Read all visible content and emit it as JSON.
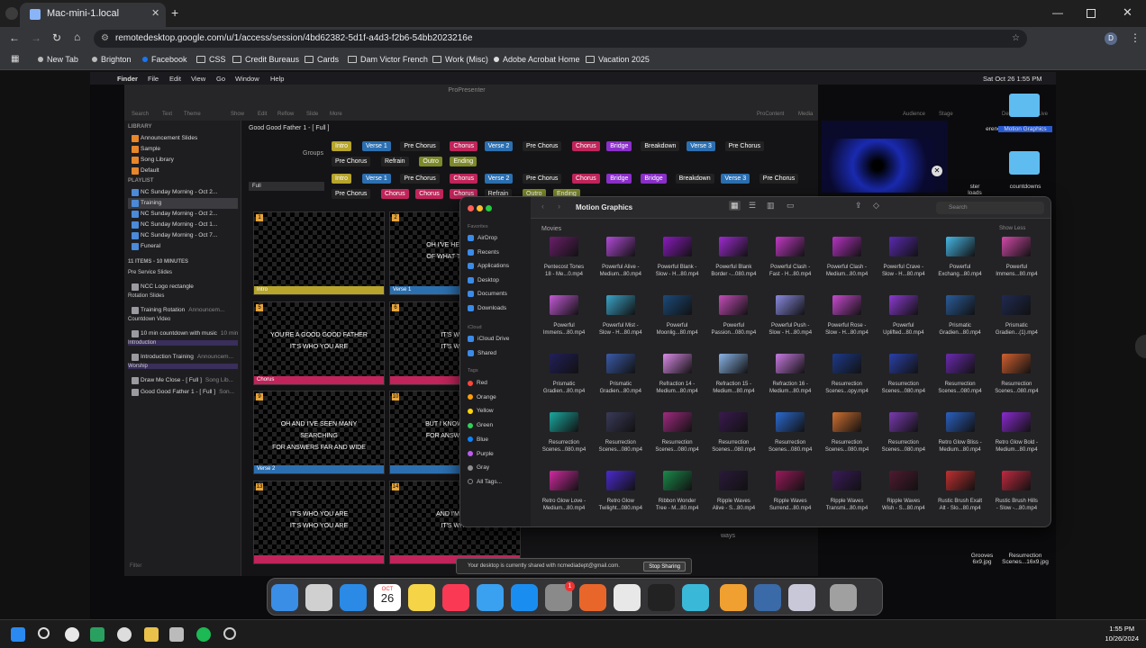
{
  "browser": {
    "tab_title": "Mac-mini-1.local",
    "url": "remotedesktop.google.com/u/1/access/session/4bd62382-5d1f-a4d3-f2b6-54bb2023216e",
    "bookmarks": [
      "New Tab",
      "Brighton",
      "Facebook",
      "CSS",
      "Credit Bureaus",
      "Cards",
      "Dam Victor French",
      "Work (Misc)",
      "Adobe Acrobat Home",
      "Vacation 2025"
    ],
    "profile_initial": "D"
  },
  "mac_menu": {
    "app": "Finder",
    "items": [
      "File",
      "Edit",
      "View",
      "Go",
      "Window",
      "Help"
    ],
    "clock": "Sat Oct 26  1:55 PM"
  },
  "pp": {
    "title": "ProPresenter",
    "toolbar": [
      "Search",
      "Text",
      "Theme",
      "Show",
      "Edit",
      "Reflow",
      "Slide",
      "More",
      "ProContent",
      "Media",
      "Audience",
      "Stage",
      "Default",
      "Live"
    ],
    "doc_title": "Good Good Father 1 - [ Full ]",
    "groups_label": "Groups",
    "arrangement": "Full",
    "library_header": "LIBRARY",
    "library": [
      "Announcement Slides",
      "Sample",
      "Song Library",
      "Default"
    ],
    "playlist_header": "PLAYLIST",
    "playlists": [
      "NC Sunday Morning - Oct 2...",
      "Training",
      "NC Sunday Morning - Oct 2...",
      "NC Sunday Morning - Oct 1...",
      "NC Sunday Morning - Oct 7...",
      "Funeral"
    ],
    "items_count": "11 ITEMS - 10 MINUTES",
    "items": [
      {
        "hdr": "Pre Service Slides"
      },
      {
        "row": "NCC Logo rectangle"
      },
      {
        "hdr": "Rotation Slides"
      },
      {
        "row": "Training Rotation",
        "meta": "Announcem..."
      },
      {
        "hdr": "Countdown Video"
      },
      {
        "row": "10 min countdown with music",
        "meta": "10 min..."
      },
      {
        "hdr": "Introduction"
      },
      {
        "row": "Introduction Training",
        "meta": "Announcem..."
      },
      {
        "hdr": "Worship"
      },
      {
        "row": "Draw Me Close - [ Full ]",
        "meta": "Song Lib..."
      },
      {
        "row": "Good Good Father 1 - [ Full ]",
        "meta": "Son..."
      }
    ],
    "filter": "Filter",
    "group_row1": [
      {
        "t": "Intro",
        "c": "#b7a52c"
      },
      {
        "t": "Verse 1",
        "c": "#2c6fb0"
      },
      {
        "t": "Pre Chorus",
        "c": "#222"
      },
      {
        "t": "Chorus",
        "c": "#c0245a"
      },
      {
        "t": "Verse 2",
        "c": "#2c6fb0"
      },
      {
        "t": "Pre Chorus",
        "c": "#222"
      },
      {
        "t": "Chorus",
        "c": "#c0245a"
      },
      {
        "t": "Bridge",
        "c": "#8b2fc9"
      },
      {
        "t": "Breakdown",
        "c": "#222"
      },
      {
        "t": "Verse 3",
        "c": "#2c6fb0"
      },
      {
        "t": "Pre Chorus",
        "c": "#222"
      }
    ],
    "group_row2": [
      {
        "t": "Pre Chorus",
        "c": "#222"
      },
      {
        "t": "Refrain",
        "c": "#222"
      },
      {
        "t": "Outro",
        "c": "#7d8a2a"
      },
      {
        "t": "Ending",
        "c": "#7d8a2a"
      }
    ],
    "arr_row1": [
      {
        "t": "Intro",
        "c": "#b7a52c"
      },
      {
        "t": "Verse 1",
        "c": "#2c6fb0"
      },
      {
        "t": "Pre Chorus",
        "c": "#222"
      },
      {
        "t": "Chorus",
        "c": "#c0245a"
      },
      {
        "t": "Verse 2",
        "c": "#2c6fb0"
      },
      {
        "t": "Pre Chorus",
        "c": "#222"
      },
      {
        "t": "Chorus",
        "c": "#c0245a"
      },
      {
        "t": "Bridge",
        "c": "#8b2fc9"
      },
      {
        "t": "Bridge",
        "c": "#8b2fc9"
      },
      {
        "t": "Breakdown",
        "c": "#222"
      },
      {
        "t": "Verse 3",
        "c": "#2c6fb0"
      },
      {
        "t": "Pre Chorus",
        "c": "#222"
      }
    ],
    "arr_row2": [
      {
        "t": "Pre Chorus",
        "c": "#222"
      },
      {
        "t": "Chorus",
        "c": "#c0245a"
      },
      {
        "t": "Chorus",
        "c": "#c0245a"
      },
      {
        "t": "Chorus",
        "c": "#c0245a"
      },
      {
        "t": "Refrain",
        "c": "#222"
      },
      {
        "t": "Outro",
        "c": "#7d8a2a"
      },
      {
        "t": "Ending",
        "c": "#7d8a2a"
      }
    ],
    "slides": [
      {
        "n": "1",
        "label": "Intro",
        "bar": "#b7a52c",
        "text": ""
      },
      {
        "n": "2",
        "label": "Verse 1",
        "bar": "#2c6fb0",
        "text": "OH I'VE HEARD A T|OF WHAT THEY TH"
      },
      {
        "n": "5",
        "label": "Chorus",
        "bar": "#c0245a",
        "text": "YOU'RE A GOOD GOOD FATHER|IT'S WHO YOU ARE"
      },
      {
        "n": "6",
        "label": "",
        "bar": "#c0245a",
        "text": "IT'S WHO|IT'S WHO"
      },
      {
        "n": "9",
        "label": "Verse 2",
        "bar": "#2c6fb0",
        "text": "OH AND I'VE SEEN MANY|SEARCHING|FOR ANSWERS FAR AND WIDE"
      },
      {
        "n": "10",
        "label": "",
        "bar": "#2c6fb0",
        "text": "BUT I KNOW WE'RE|FOR ANSWERS ON"
      },
      {
        "n": "13",
        "label": "",
        "bar": "#c0245a",
        "text": "IT'S WHO YOU ARE|IT'S WHO YOU ARE"
      },
      {
        "n": "14",
        "label": "",
        "bar": "#c0245a",
        "text": "AND I'M LOV|IT'S WHO"
      }
    ],
    "stage_text": "ways"
  },
  "finder": {
    "title": "Motion Graphics",
    "search_placeholder": "Search",
    "section": "Movies",
    "show_less": "Show Less",
    "favorites_header": "Favorites",
    "favorites": [
      "AirDrop",
      "Recents",
      "Applications",
      "Desktop",
      "Documents",
      "Downloads"
    ],
    "icloud_header": "iCloud",
    "icloud": [
      "iCloud Drive",
      "Shared"
    ],
    "tags_header": "Tags",
    "tags": [
      {
        "n": "Red",
        "c": "#ff453a"
      },
      {
        "n": "Orange",
        "c": "#ff9f0a"
      },
      {
        "n": "Yellow",
        "c": "#ffd60a"
      },
      {
        "n": "Green",
        "c": "#30d158"
      },
      {
        "n": "Blue",
        "c": "#0a84ff"
      },
      {
        "n": "Purple",
        "c": "#bf5af2"
      },
      {
        "n": "Gray",
        "c": "#8e8e93"
      },
      {
        "n": "All Tags...",
        "c": ""
      }
    ],
    "files": [
      [
        "Pentecost Tones|18 - Me...0.mp4",
        "Powerful Alive -|Medium...80.mp4",
        "Powerful Blank -|Slow - H...80.mp4",
        "Powerful Blank|Border -...080.mp4",
        "Powerful Clash -|Fast - H...80.mp4",
        "Powerful Clash -|Medium...80.mp4",
        "Powerful Crave -|Slow - H...80.mp4",
        "Powerful|Exchang...80.mp4",
        "Powerful|Immens...80.mp4"
      ],
      [
        "Powerful|Immens...80.mp4",
        "Powerful Mist -|Slow - H...80.mp4",
        "Powerful|Moonlig...80.mp4",
        "Powerful|Passion...080.mp4",
        "Powerful Push -|Slow - H...80.mp4",
        "Powerful Rose -|Slow - H...80.mp4",
        "Powerful|Uplifted...80.mp4",
        "Prismatic|Gradien...80.mp4",
        "Prismatic|Gradien...(1).mp4"
      ],
      [
        "Prismatic|Gradien...80.mp4",
        "Prismatic|Gradien...80.mp4",
        "Refraction 14 -|Medium...80.mp4",
        "Refraction 15 -|Medium...80.mp4",
        "Refraction 16 -|Medium...80.mp4",
        "Resurrection|Scenes...opy.mp4",
        "Resurrection|Scenes...080.mp4",
        "Resurrection|Scenes...080.mp4",
        "Resurrection|Scenes...080.mp4"
      ],
      [
        "Resurrection|Scenes...080.mp4",
        "Resurrection|Scenes...080.mp4",
        "Resurrection|Scenes...080.mp4",
        "Resurrection|Scenes...080.mp4",
        "Resurrection|Scenes...080.mp4",
        "Resurrection|Scenes...080.mp4",
        "Resurrection|Scenes...080.mp4",
        "Retro Glow Bliss -|Medium...80.mp4",
        "Retro Glow Bold -|Medium...80.mp4"
      ],
      [
        "Retro Glow Love -|Medium...80.mp4",
        "Retro Glow|Twilight...080.mp4",
        "Ribbon Wonder|Tree - M...80.mp4",
        "Ripple Waves|Alive - S...80.mp4",
        "Ripple Waves|Surrend...80.mp4",
        "Ripple Waves|Transmi...80.mp4",
        "Ripple Waves|Wish - S...80.mp4",
        "Rustic Brush Exalt|Alt - Slo...80.mp4",
        "Rustic Brush Hills|- Slow -...80.mp4"
      ]
    ],
    "thumb_colors": [
      [
        "#6a1f6a",
        "#b14bd6",
        "#8a1bbd",
        "#9d2bd0",
        "#c13ac4",
        "#b533c2",
        "#5a2ab0",
        "#47b8e6",
        "#d14aa8"
      ],
      [
        "#c35ad6",
        "#3aa4c8",
        "#1b4a7a",
        "#c44db8",
        "#8a8ae0",
        "#c84ad0",
        "#8c3ad0",
        "#2a5c9a",
        "#202a50"
      ],
      [
        "#221f5a",
        "#3a5aa8",
        "#d98ae6",
        "#8ab4e8",
        "#c77ae0",
        "#1d3a8a",
        "#2a40a8",
        "#6a2ab0",
        "#d06030"
      ],
      [
        "#1aa8a0",
        "#3a3a5a",
        "#a02a80",
        "#3a1a50",
        "#2a6ad0",
        "#d07030",
        "#7a3ab0",
        "#2a60c0",
        "#8a2ad0"
      ],
      [
        "#d02aa0",
        "#4a2ad0",
        "#1a8a4a",
        "#2a1a3a",
        "#9a1a5a",
        "#3a1a5a",
        "#501a30",
        "#c03030",
        "#c02a40"
      ]
    ]
  },
  "desktop": [
    {
      "label": "erence"
    },
    {
      "label": "Motion Graphics"
    },
    {
      "label": "ster|loads"
    },
    {
      "label": "countdowns"
    },
    {
      "label": "Grooves|6x9.jpg"
    },
    {
      "label": "Resurrection|Scenes...16x9.jpg"
    }
  ],
  "share": {
    "message": "Your desktop is currently shared with ncmediadept@gmail.com.",
    "stop": "Stop Sharing"
  },
  "dock": [
    {
      "n": "finder",
      "c": "#3a8ee6"
    },
    {
      "n": "launchpad",
      "c": "#d0d0d0"
    },
    {
      "n": "safari",
      "c": "#2a8ae6"
    },
    {
      "n": "calendar",
      "c": "#ffffff"
    },
    {
      "n": "notes",
      "c": "#f5d547"
    },
    {
      "n": "music",
      "c": "#fa3a55"
    },
    {
      "n": "keynote",
      "c": "#3aa0f0"
    },
    {
      "n": "app-store",
      "c": "#1a8ef0"
    },
    {
      "n": "system-settings",
      "c": "#8a8a8a"
    },
    {
      "n": "office",
      "c": "#e8662a"
    },
    {
      "n": "chrome",
      "c": "#e8e8e8"
    },
    {
      "n": "piano",
      "c": "#222222"
    },
    {
      "n": "sphere",
      "c": "#3ab8d8"
    },
    {
      "n": "pencil",
      "c": "#f0a030"
    },
    {
      "n": "quicktime",
      "c": "#3a6aa8"
    },
    {
      "n": "preview",
      "c": "#c8c8d8"
    },
    {
      "n": "trash",
      "c": "#a0a0a0"
    }
  ],
  "calendar": {
    "month": "OCT",
    "day": "26"
  },
  "settings_badge": "1",
  "taskbar": {
    "time": "1:55 PM",
    "date": "10/26/2024"
  }
}
